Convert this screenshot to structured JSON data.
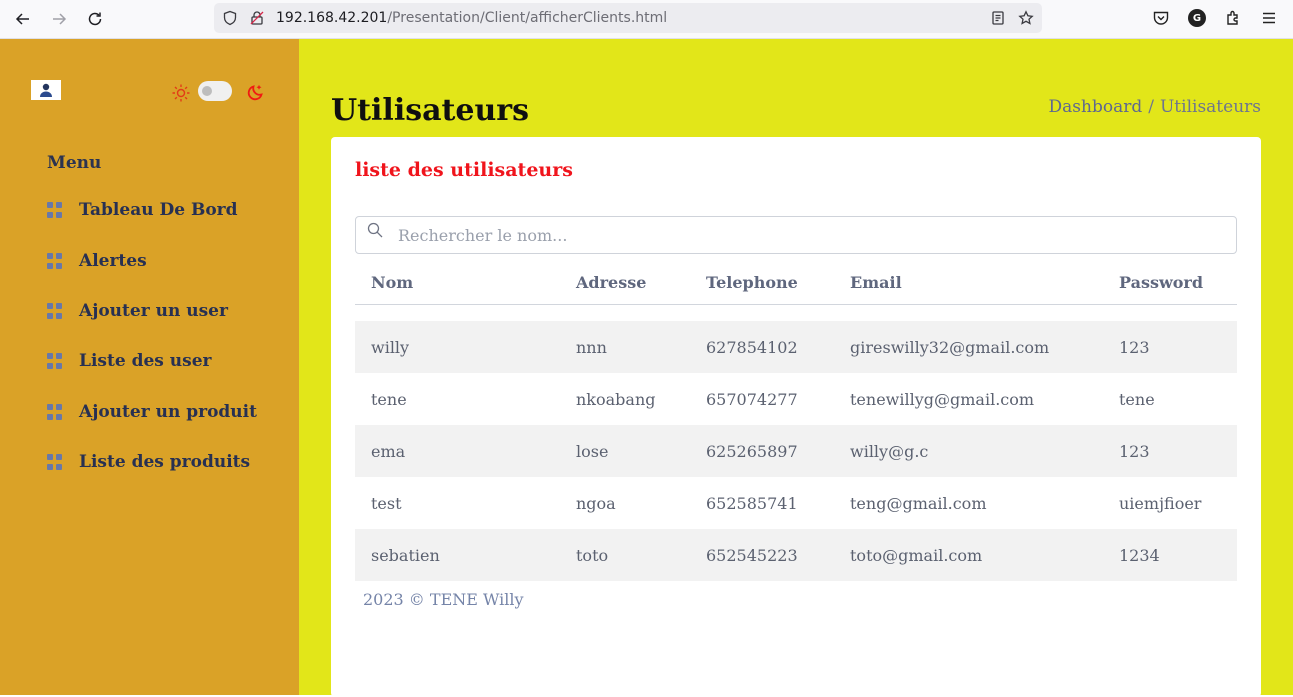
{
  "browser": {
    "url_host": "192.168.42.201",
    "url_path": "/Presentation/Client/afficherClients.html",
    "avatar_letter": "G"
  },
  "sidebar": {
    "menu_title": "Menu",
    "items": [
      {
        "label": "Tableau De Bord"
      },
      {
        "label": "Alertes"
      },
      {
        "label": "Ajouter un user"
      },
      {
        "label": "Liste des user"
      },
      {
        "label": "Ajouter un produit"
      },
      {
        "label": "Liste des produits"
      }
    ]
  },
  "header": {
    "title": "Utilisateurs",
    "breadcrumb": {
      "link": "Dashboard",
      "separator": "/",
      "current": "Utilisateurs"
    }
  },
  "card": {
    "title": "liste des utilisateurs",
    "search_placeholder": "Rechercher le nom..."
  },
  "table": {
    "columns": [
      "Nom",
      "Adresse",
      "Telephone",
      "Email",
      "Password"
    ],
    "rows": [
      [
        "willy",
        "nnn",
        "627854102",
        "gireswilly32@gmail.com",
        "123"
      ],
      [
        "tene",
        "nkoabang",
        "657074277",
        "tenewillyg@gmail.com",
        "tene"
      ],
      [
        "ema",
        "lose",
        "625265897",
        "willy@g.c",
        "123"
      ],
      [
        "test",
        "ngoa",
        "652585741",
        "teng@gmail.com",
        "uiemjfioer"
      ],
      [
        "sebatien",
        "toto",
        "652545223",
        "toto@gmail.com",
        "1234"
      ]
    ]
  },
  "footer": {
    "text": "2023 © TENE Willy"
  },
  "colors": {
    "sidebar_bg": "#daa227",
    "main_bg": "#e2e619",
    "card_title": "#f0141c",
    "stripe": "#f2f2f2"
  }
}
